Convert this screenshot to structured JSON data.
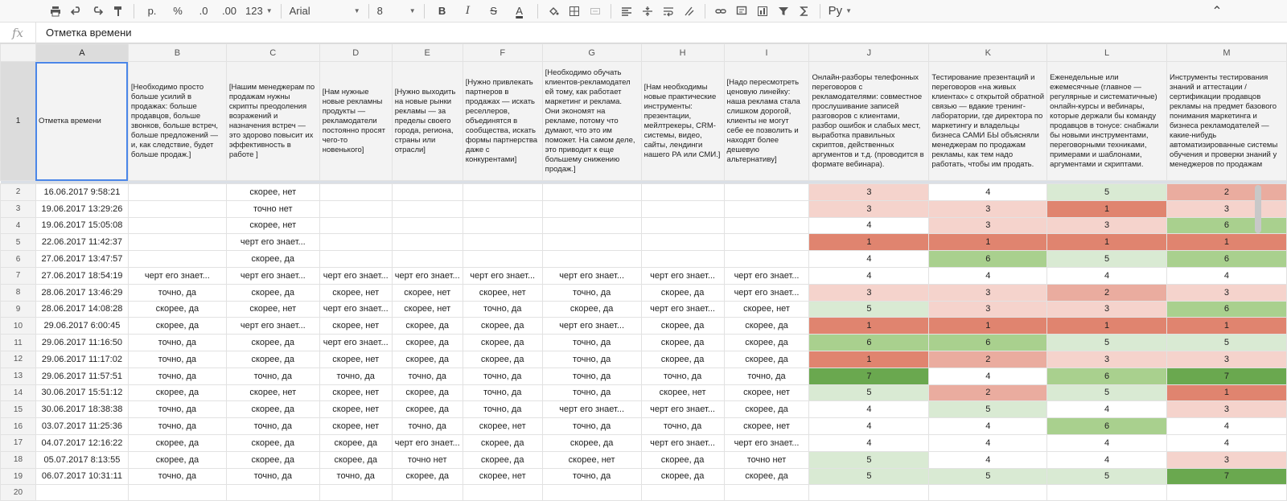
{
  "toolbar": {
    "items": [
      {
        "name": "print-icon",
        "glyph": "🖶"
      },
      {
        "name": "undo-icon",
        "glyph": "↶"
      },
      {
        "name": "redo-icon",
        "glyph": "↷"
      },
      {
        "name": "paint-format-icon",
        "glyph": "🖌"
      }
    ],
    "currency": "р.",
    "percent": "%",
    "decimal_decrease": ".0",
    "decimal_increase": ".00",
    "more_formats": "123",
    "font": "Arial",
    "font_size": "8",
    "bold": "B",
    "italic": "I",
    "strike": "S",
    "text_color": "A",
    "input_tools": "Ру",
    "collapse": "⌃"
  },
  "formula_bar": {
    "fx": "fx",
    "value": "Отметка времени"
  },
  "columns": [
    "A",
    "B",
    "C",
    "D",
    "E",
    "F",
    "G",
    "H",
    "I",
    "J",
    "K",
    "L",
    "M"
  ],
  "header_row": {
    "row_number": "1",
    "cells": [
      "Отметка времени",
      "[Необходимо просто больше усилий в продажах: больше продавцов, больше звонков, больше встреч, больше предложений — и, как следствие, будет больше продаж.]",
      "[Нашим менеджерам по продажам нужны скрипты преодоления возражений и назначения встреч — это здорово повысит их эффективность в работе ]",
      "[Нам нужные новые рекламны продукты — рекламодатели постоянно просят чего-то новенького]",
      "[Нужно выходить на новые рынки рекламы — за пределы своего города, региона, страны или отрасли]",
      "[Нужно привлекать партнеров в продажах — искать реселлеров, объединятся в сообщества, искать формы партнерства даже с конкурентами]",
      "[Необходимо обучать клиентов-рекламодател ей тому, как работает маркетинг и реклама. Они экономят на рекламе, потому что думают, что это им поможет. На самом деле, это приводит к еще большему снижению продаж.]",
      "[Нам необходимы новые практические инструменты: презентации, мейлтрекеры, CRM-системы, видео, сайты, лендинги нашего РА или СМИ.]",
      "[Надо пересмотреть ценовую линейку: наша реклама стала слишком дорогой, клиенты не могут себе ее позволить и находят более дешевую альтернативу]",
      "Онлайн-разборы телефонных переговоров с рекламодателями: совместное прослушивание записей разговоров с клиентами, разбор ошибок и слабых мест, выработка правильных скриптов, действенных аргументов и т.д. (проводится в формате вебинара).",
      "Тестирование презентаций и переговоров «на живых клиентах» с открытой обратной связью — вдакие тренинг-лаборатории, где директора по маркетингу и владельцы бизнеса САМИ БЫ объясняли менеджерам по продажам рекламы, как тем надо работать, чтобы им продать.",
      "Еженедельные или ежемесячные (главное — регулярные и систематичные) онлайн-курсы и вебинары, которые держали бы команду продавцов в тонусе: снабжали бы новыми инструментами, переговорными техниками, примерами и шаблонами, аргументами и скриптами.",
      "Инструменты тестирования знаний и аттестации / сертификации продавцов рекламы на предмет базового понимания маркетинга и бизнеса рекламодателей — какие-нибудь автоматизированные системы обучения и проверки знаний у менеджеров по продажам"
    ]
  },
  "rows": [
    {
      "n": "2",
      "cells": [
        "16.06.2017 9:58:21",
        "",
        "скорее, нет",
        "",
        "",
        "",
        "",
        "",
        "",
        "3",
        "4",
        "5",
        "2"
      ]
    },
    {
      "n": "3",
      "cells": [
        "19.06.2017 13:29:26",
        "",
        "точно нет",
        "",
        "",
        "",
        "",
        "",
        "",
        "3",
        "3",
        "1",
        "3"
      ]
    },
    {
      "n": "4",
      "cells": [
        "19.06.2017 15:05:08",
        "",
        "скорее, нет",
        "",
        "",
        "",
        "",
        "",
        "",
        "4",
        "3",
        "3",
        "6"
      ]
    },
    {
      "n": "5",
      "cells": [
        "22.06.2017 11:42:37",
        "",
        "черт его знает...",
        "",
        "",
        "",
        "",
        "",
        "",
        "1",
        "1",
        "1",
        "1"
      ]
    },
    {
      "n": "6",
      "cells": [
        "27.06.2017 13:47:57",
        "",
        "скорее, да",
        "",
        "",
        "",
        "",
        "",
        "",
        "4",
        "6",
        "5",
        "6"
      ]
    },
    {
      "n": "7",
      "cells": [
        "27.06.2017 18:54:19",
        "черт его знает...",
        "черт его знает...",
        "черт его знает...",
        "черт его знает...",
        "черт его знает...",
        "черт его знает...",
        "черт его знает...",
        "черт его знает...",
        "4",
        "4",
        "4",
        "4"
      ]
    },
    {
      "n": "8",
      "cells": [
        "28.06.2017 13:46:29",
        "точно, да",
        "скорее, да",
        "скорее, нет",
        "скорее, нет",
        "скорее, нет",
        "точно, да",
        "скорее, да",
        "черт его знает...",
        "3",
        "3",
        "2",
        "3"
      ]
    },
    {
      "n": "9",
      "cells": [
        "28.06.2017 14:08:28",
        "скорее, да",
        "скорее, нет",
        "черт его знает...",
        "скорее, нет",
        "точно, да",
        "скорее, да",
        "черт его знает...",
        "скорее, нет",
        "5",
        "3",
        "3",
        "6"
      ]
    },
    {
      "n": "10",
      "cells": [
        "29.06.2017 6:00:45",
        "скорее, да",
        "черт его знает...",
        "скорее, нет",
        "скорее, да",
        "скорее, да",
        "черт его знает...",
        "скорее, да",
        "скорее, да",
        "1",
        "1",
        "1",
        "1"
      ]
    },
    {
      "n": "11",
      "cells": [
        "29.06.2017 11:16:50",
        "точно, да",
        "скорее, да",
        "черт его знает...",
        "скорее, да",
        "скорее, да",
        "точно, да",
        "скорее, да",
        "скорее, да",
        "6",
        "6",
        "5",
        "5"
      ]
    },
    {
      "n": "12",
      "cells": [
        "29.06.2017 11:17:02",
        "точно, да",
        "скорее, да",
        "скорее, нет",
        "скорее, да",
        "скорее, да",
        "точно, да",
        "скорее, да",
        "скорее, да",
        "1",
        "2",
        "3",
        "3"
      ]
    },
    {
      "n": "13",
      "cells": [
        "29.06.2017 11:57:51",
        "точно, да",
        "точно, да",
        "точно, да",
        "точно, да",
        "точно, да",
        "точно, да",
        "точно, да",
        "точно, да",
        "7",
        "4",
        "6",
        "7"
      ]
    },
    {
      "n": "14",
      "cells": [
        "30.06.2017 15:51:12",
        "скорее, да",
        "скорее, нет",
        "скорее, нет",
        "скорее, да",
        "точно, да",
        "точно, да",
        "скорее, нет",
        "скорее, нет",
        "5",
        "2",
        "5",
        "1"
      ]
    },
    {
      "n": "15",
      "cells": [
        "30.06.2017 18:38:38",
        "точно, да",
        "скорее, да",
        "скорее, нет",
        "скорее, да",
        "точно, да",
        "черт его знает...",
        "черт его знает...",
        "скорее, да",
        "4",
        "5",
        "4",
        "3"
      ]
    },
    {
      "n": "16",
      "cells": [
        "03.07.2017 11:25:36",
        "точно, да",
        "точно, да",
        "скорее, нет",
        "точно, да",
        "скорее, нет",
        "точно, да",
        "точно, да",
        "скорее, нет",
        "4",
        "4",
        "6",
        "4"
      ]
    },
    {
      "n": "17",
      "cells": [
        "04.07.2017 12:16:22",
        "скорее, да",
        "скорее, да",
        "скорее, да",
        "черт его знает...",
        "скорее, да",
        "скорее, да",
        "черт его знает...",
        "черт его знает...",
        "4",
        "4",
        "4",
        "4"
      ]
    },
    {
      "n": "18",
      "cells": [
        "05.07.2017 8:13:55",
        "скорее, да",
        "скорее, да",
        "скорее, да",
        "точно нет",
        "скорее, да",
        "скорее, нет",
        "скорее, да",
        "точно нет",
        "5",
        "4",
        "4",
        "3"
      ]
    },
    {
      "n": "19",
      "cells": [
        "06.07.2017 10:31:11",
        "точно, да",
        "точно, да",
        "точно, да",
        "скорее, да",
        "скорее, нет",
        "точно, да",
        "скорее, да",
        "скорее, да",
        "5",
        "5",
        "5",
        "7"
      ]
    }
  ],
  "empty_row": {
    "n": "20"
  },
  "scale_colors": {
    "1": "#e0846f",
    "2": "#eaac9f",
    "3": "#f5d3cc",
    "4": "#ffffff",
    "5": "#d9ead3",
    "6": "#a9d08e",
    "7": "#6aa84f"
  }
}
